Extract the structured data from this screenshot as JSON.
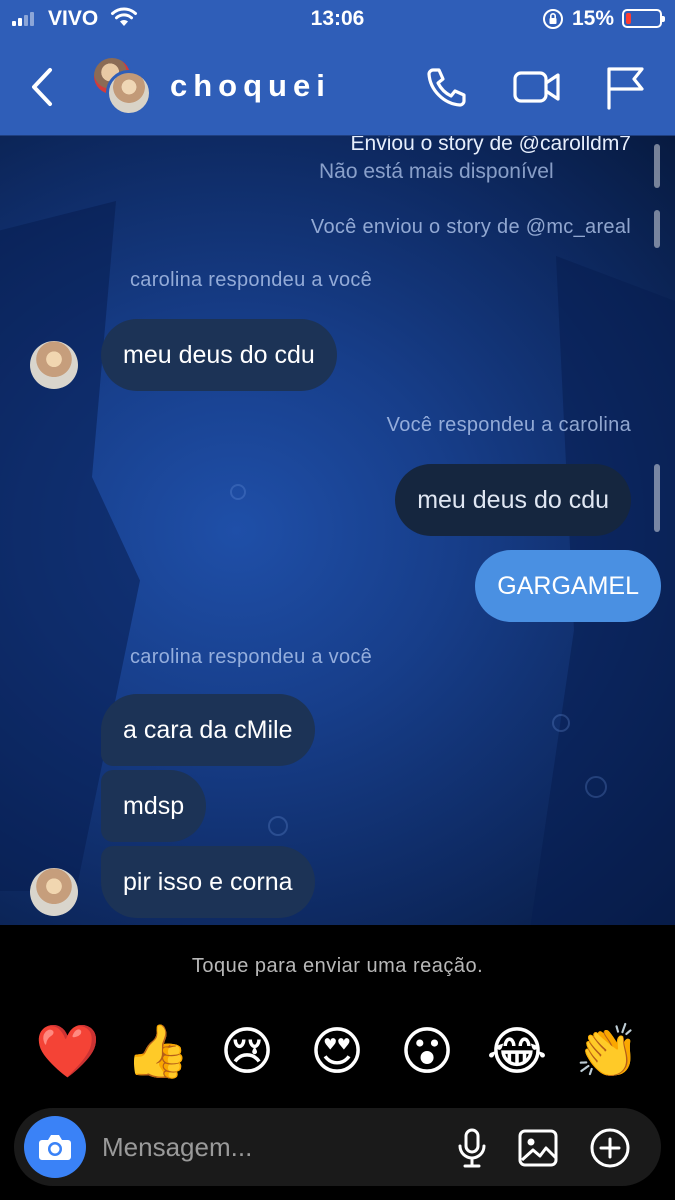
{
  "status_bar": {
    "carrier": "VIVO",
    "time": "13:06",
    "battery_percent": "15%",
    "battery_level": 0.15
  },
  "header": {
    "title": "choquei"
  },
  "messages": {
    "story_reply_title": "Enviou o story de @carolldm7",
    "story_unavailable": "Não está mais disponível",
    "you_sent_story": "Você enviou o story de @mc_areal",
    "carolina_replied_1": "carolina respondeu a você",
    "msg_1": "meu deus do cdu",
    "you_replied": "Você respondeu a carolina",
    "quoted_msg": "meu deus do cdu",
    "my_msg": "GARGAMEL",
    "carolina_replied_2": "carolina respondeu a você",
    "msg_2": "a cara da cMile",
    "msg_3": "mdsp",
    "msg_4": "pir isso e corna"
  },
  "reactions": {
    "hint": "Toque para enviar uma reação.",
    "emojis": [
      "❤️",
      "👍",
      "😢",
      "😍",
      "😮",
      "😂",
      "👏"
    ],
    "emoji_names": [
      "heart",
      "thumbs-up",
      "crying-face",
      "heart-eyes",
      "surprised-face",
      "laughing-face",
      "clapping-hands"
    ]
  },
  "composer": {
    "placeholder": "Mensagem..."
  },
  "icons": {
    "back": "chevron-left-icon",
    "call": "phone-icon",
    "video": "video-camera-icon",
    "report": "flag-icon",
    "camera": "camera-icon",
    "mic": "microphone-icon",
    "gallery": "image-icon",
    "add": "plus-circle-icon"
  },
  "colors": {
    "header_bg": "#2f5eb8",
    "incoming_bubble": "#1c3356",
    "quoted_bubble": "#15263f",
    "outgoing_bubble": "#4a90e2",
    "camera_button": "#3a82f7"
  }
}
